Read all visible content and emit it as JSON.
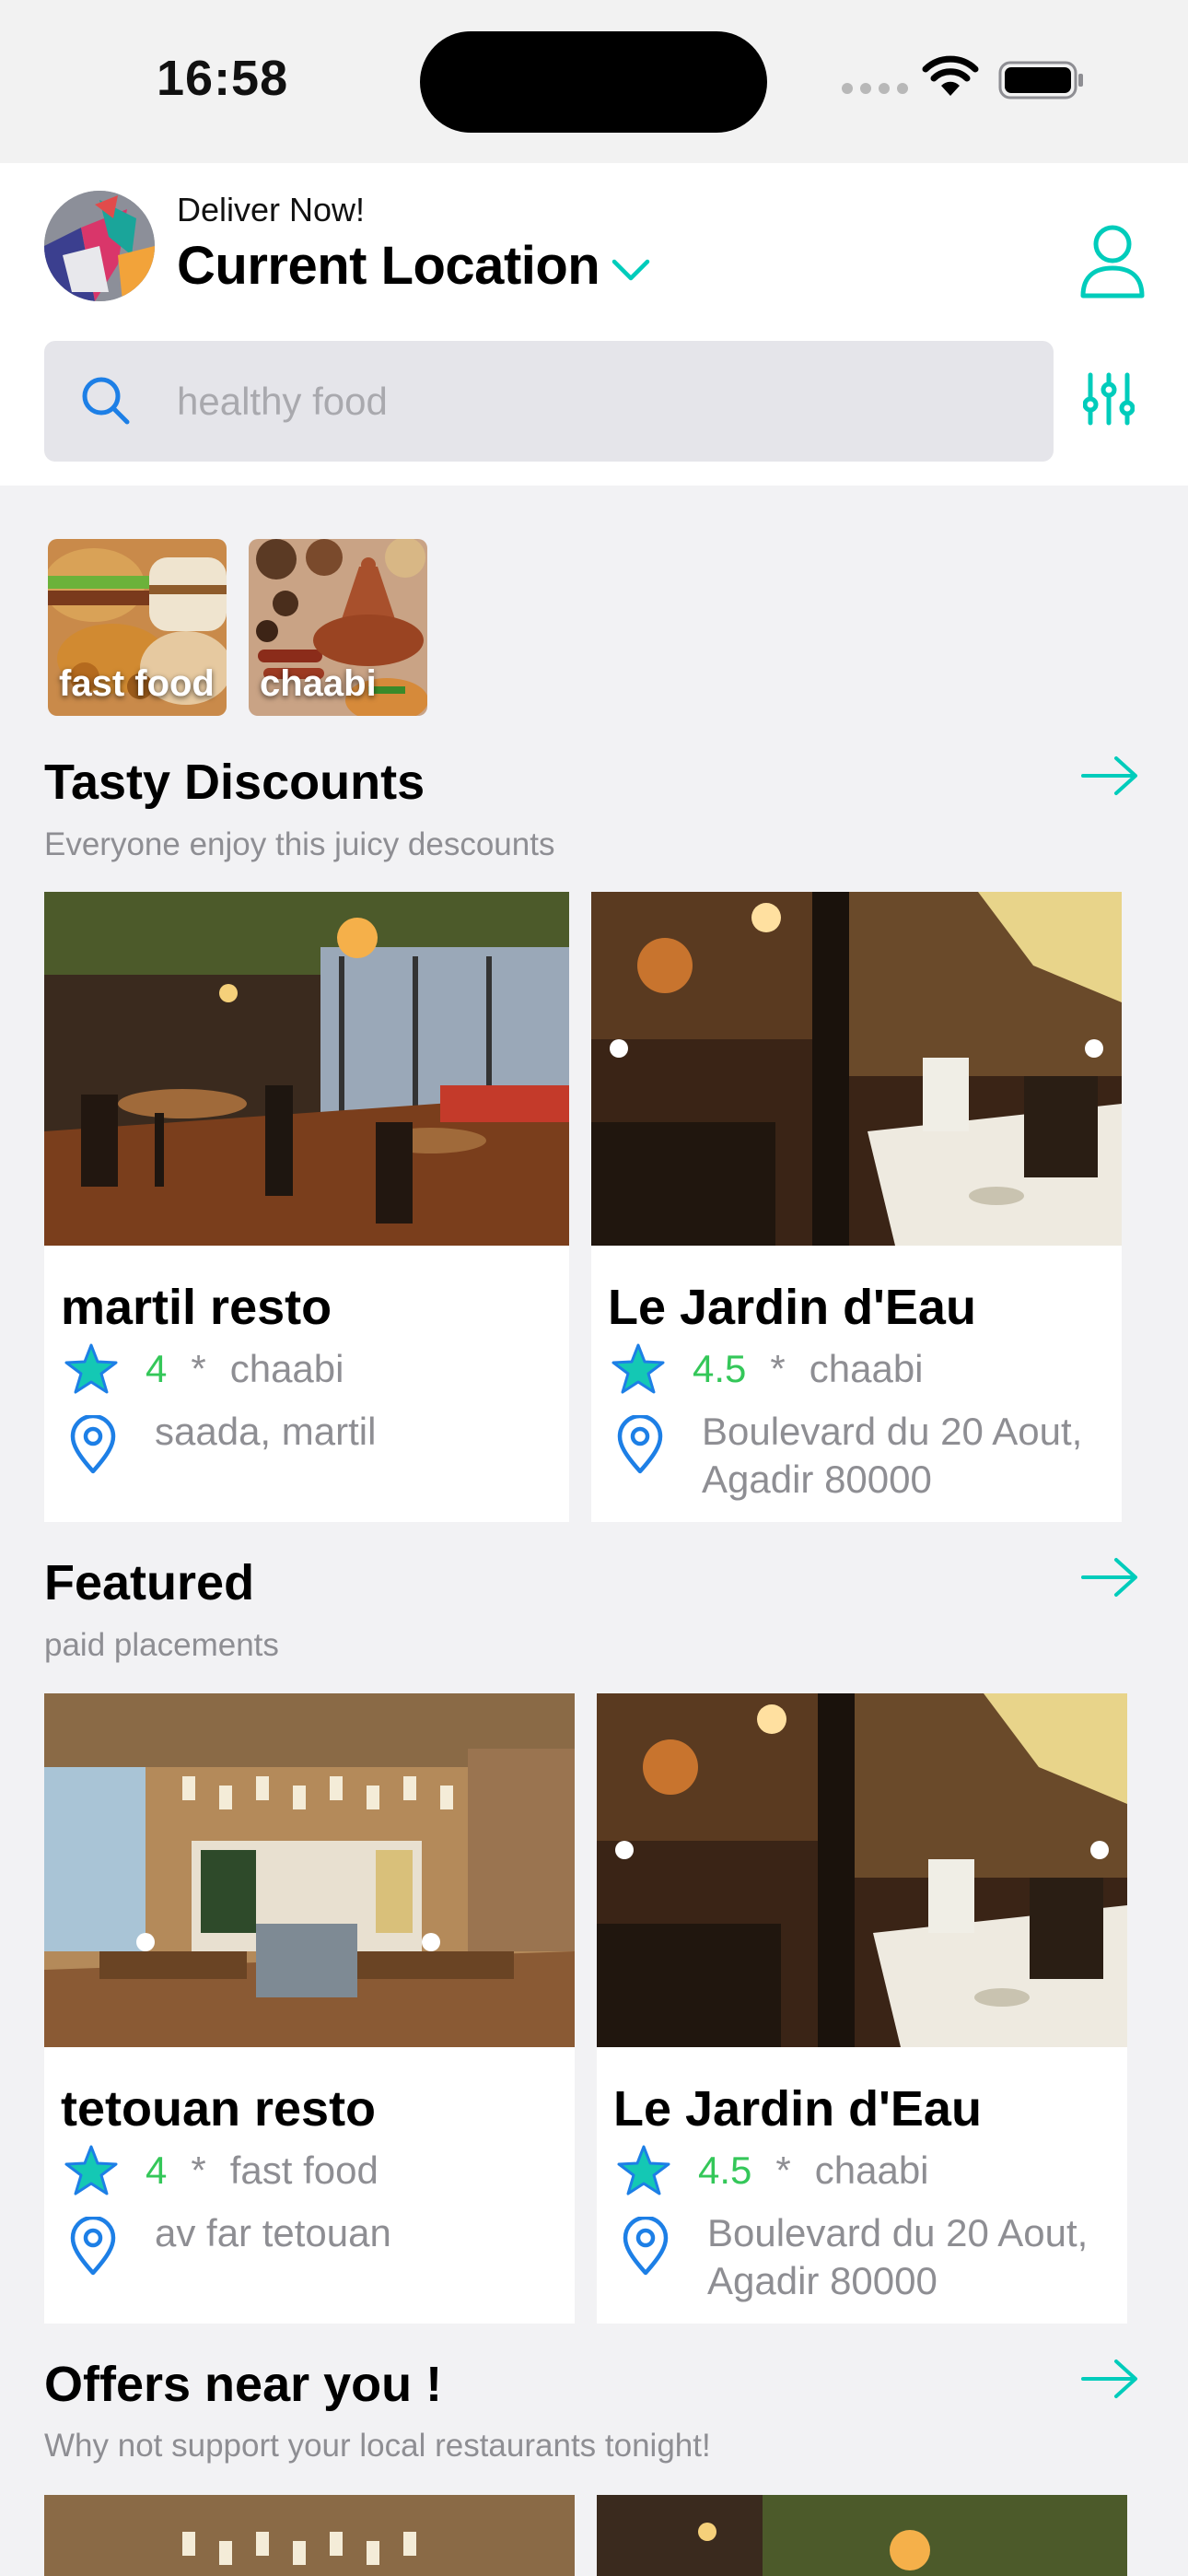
{
  "status_bar": {
    "time": "16:58"
  },
  "header": {
    "deliver_label": "Deliver Now!",
    "location_title": "Current Location",
    "search_placeholder": "healthy food"
  },
  "categories": [
    {
      "label": "fast food"
    },
    {
      "label": "chaabi"
    }
  ],
  "sections": [
    {
      "title": "Tasty Discounts",
      "subtitle": "Everyone enjoy this juicy descounts",
      "cards": [
        {
          "name": "martil resto",
          "rating": "4",
          "separator": "*",
          "cuisine": "chaabi",
          "address": "saada, martil"
        },
        {
          "name": "Le Jardin d'Eau",
          "rating": "4.5",
          "separator": "*",
          "cuisine": "chaabi",
          "address": "Boulevard du 20 Aout, Agadir 80000"
        }
      ]
    },
    {
      "title": "Featured",
      "subtitle": "paid placements",
      "cards": [
        {
          "name": "tetouan resto",
          "rating": "4",
          "separator": "*",
          "cuisine": "fast food",
          "address": "av far tetouan"
        },
        {
          "name": "Le Jardin d'Eau",
          "rating": "4.5",
          "separator": "*",
          "cuisine": "chaabi",
          "address": "Boulevard du 20 Aout, Agadir 80000"
        }
      ]
    },
    {
      "title": "Offers near you !",
      "subtitle": "Why not support your local restaurants tonight!"
    }
  ],
  "colors": {
    "accent": "#00ccbb",
    "rating_green": "#34c759",
    "icon_blue": "#1d7fe6",
    "muted_text": "#8e8e93"
  },
  "icons": {
    "search": "search-icon",
    "filter": "sliders-icon",
    "profile": "user-icon",
    "arrow": "arrow-right-icon",
    "star": "star-icon",
    "pin": "location-pin-icon",
    "chevron": "chevron-down-icon"
  }
}
